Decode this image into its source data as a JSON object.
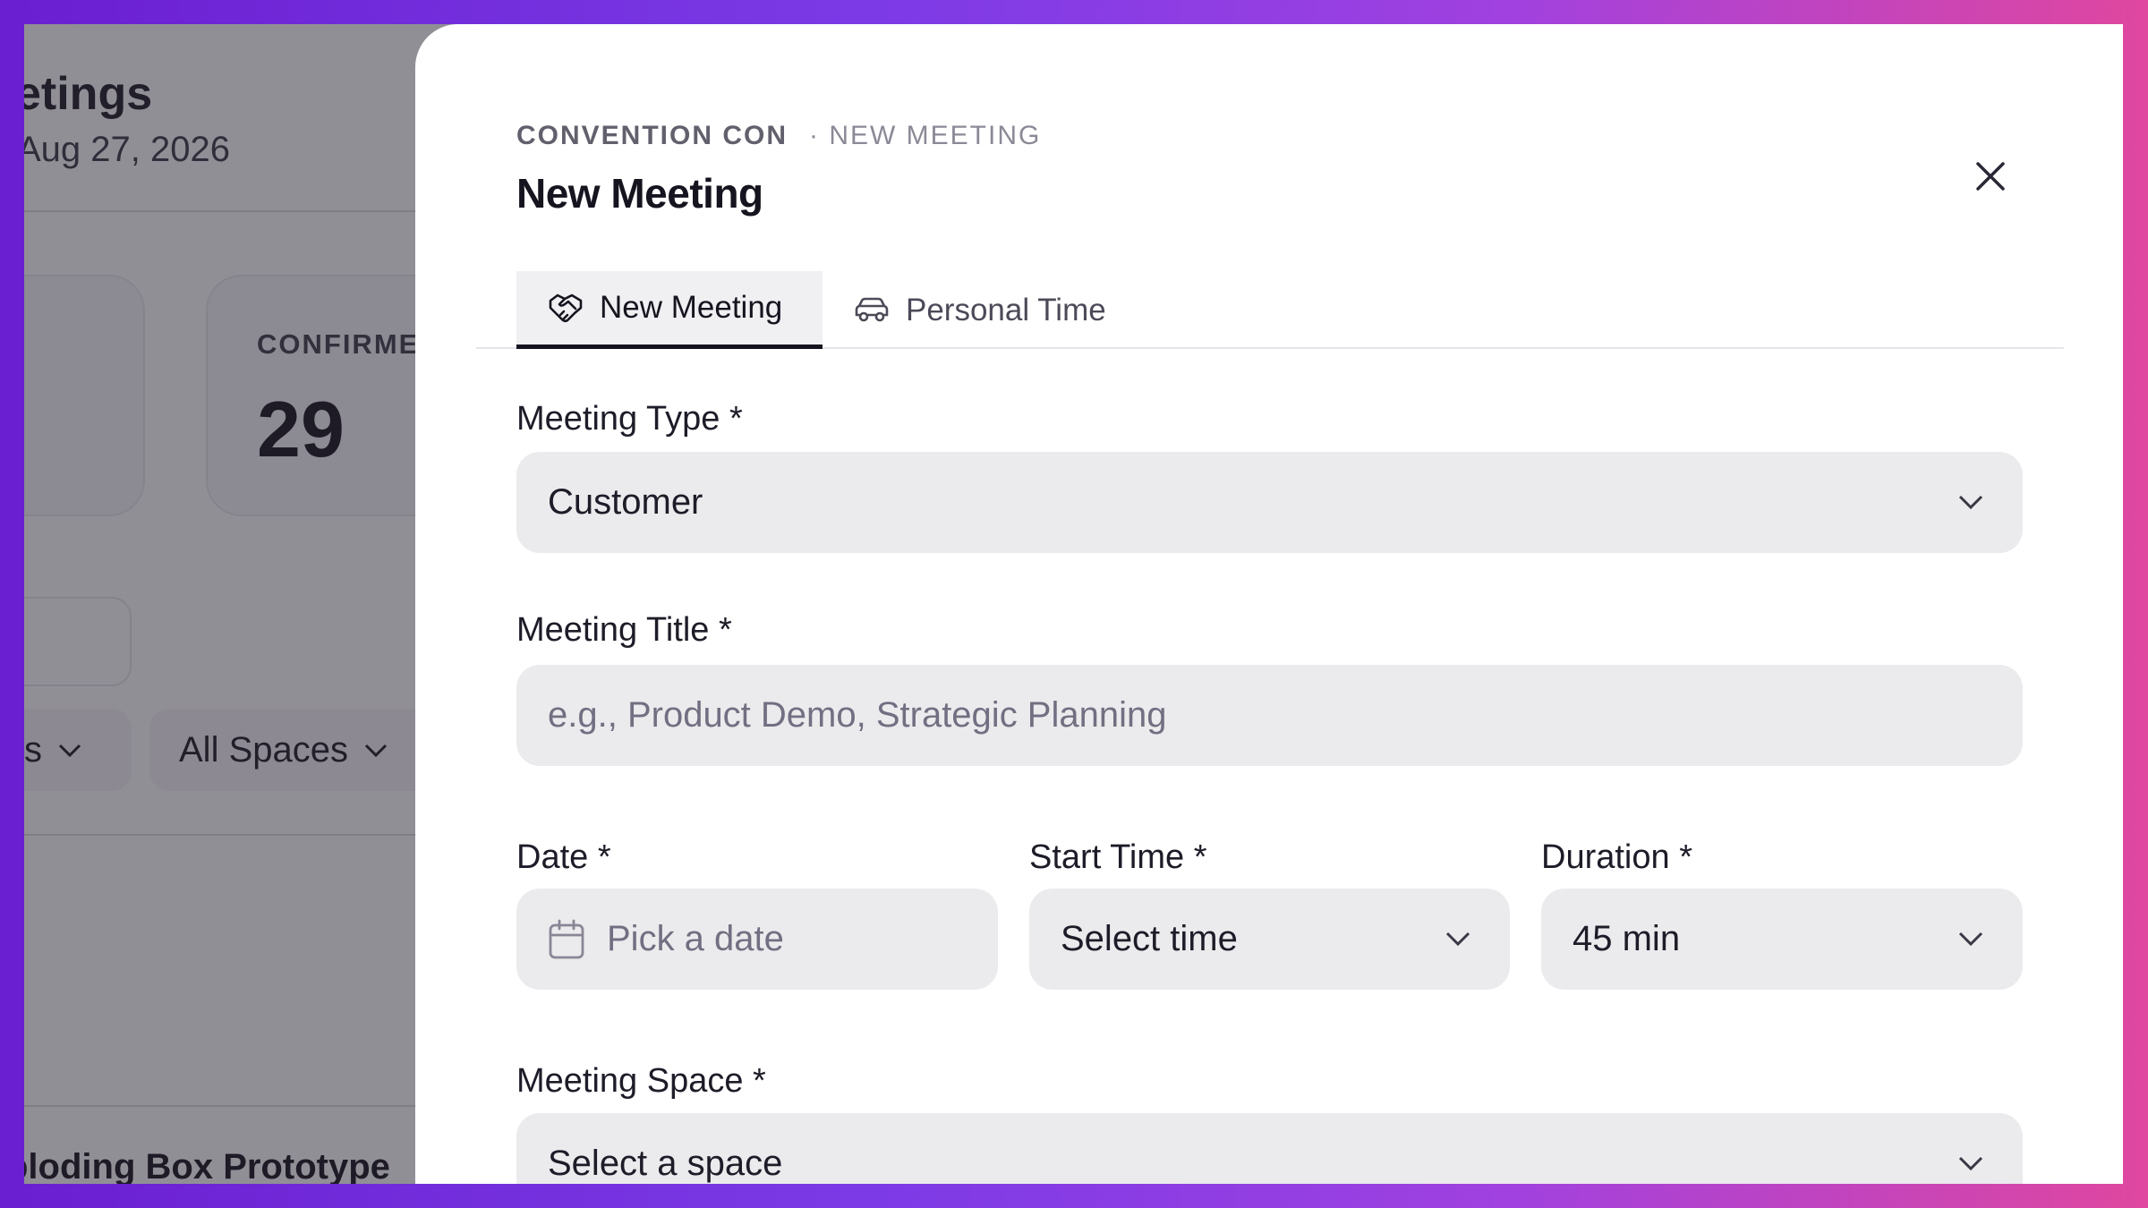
{
  "background": {
    "title": "etings",
    "date_range": "Aug 27, 2026",
    "stat_card": {
      "label": "CONFIRME",
      "value": "29"
    },
    "filter_pills": [
      "s",
      "All Spaces"
    ],
    "list_item": "ploding Box Prototype"
  },
  "drawer": {
    "org": "CONVENTION CON",
    "breadcrumb": "· NEW MEETING",
    "title": "New Meeting",
    "tabs": [
      {
        "label": "New Meeting",
        "icon": "handshake-icon",
        "active": true
      },
      {
        "label": "Personal Time",
        "icon": "car-icon",
        "active": false
      }
    ],
    "form": {
      "meeting_type": {
        "label": "Meeting Type *",
        "value": "Customer"
      },
      "meeting_title": {
        "label": "Meeting Title *",
        "value": "",
        "placeholder": "e.g., Product Demo, Strategic Planning"
      },
      "date": {
        "label": "Date *",
        "placeholder": "Pick a date"
      },
      "start_time": {
        "label": "Start Time *",
        "value": "Select time"
      },
      "duration": {
        "label": "Duration *",
        "value": "45 min"
      },
      "meeting_space": {
        "label": "Meeting Space *",
        "value": "Select a space"
      }
    }
  },
  "colors": {
    "accent_dark": "#16141e",
    "field_bg": "#ebebed",
    "gradient_left": "#6a1fd0",
    "gradient_right": "#e0479f"
  }
}
